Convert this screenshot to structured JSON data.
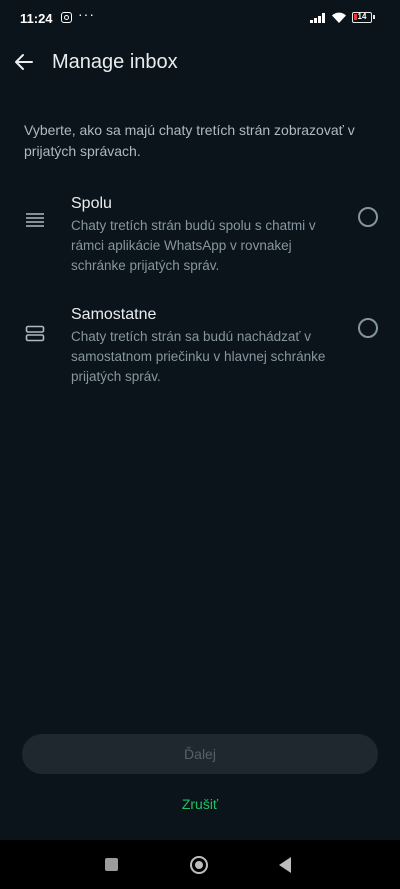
{
  "status": {
    "time": "11:24",
    "more": "···",
    "battery": "14",
    "icons": [
      "instagram-icon",
      "signal-icon",
      "wifi-icon",
      "battery-icon"
    ]
  },
  "header": {
    "title": "Manage inbox",
    "back_icon": "arrow-left-icon"
  },
  "description": "Vyberte, ako sa majú chaty tretích strán zobrazovať v prijatých správach.",
  "options": [
    {
      "title": "Spolu",
      "text": "Chaty tretích strán budú spolu s chatmi v rámci aplikácie WhatsApp v rovnakej schránke prijatých správ.",
      "icon": "list-lines-icon",
      "selected": false
    },
    {
      "title": "Samostatne",
      "text": "Chaty tretích strán sa budú nachádzať v samostatnom priečinku v hlavnej schránke prijatých správ.",
      "icon": "split-boxes-icon",
      "selected": false
    }
  ],
  "actions": {
    "next": "Ďalej",
    "cancel": "Zrušiť"
  },
  "colors": {
    "background": "#0b141a",
    "accent": "#21c063",
    "disabled_button": "#1e282e"
  }
}
